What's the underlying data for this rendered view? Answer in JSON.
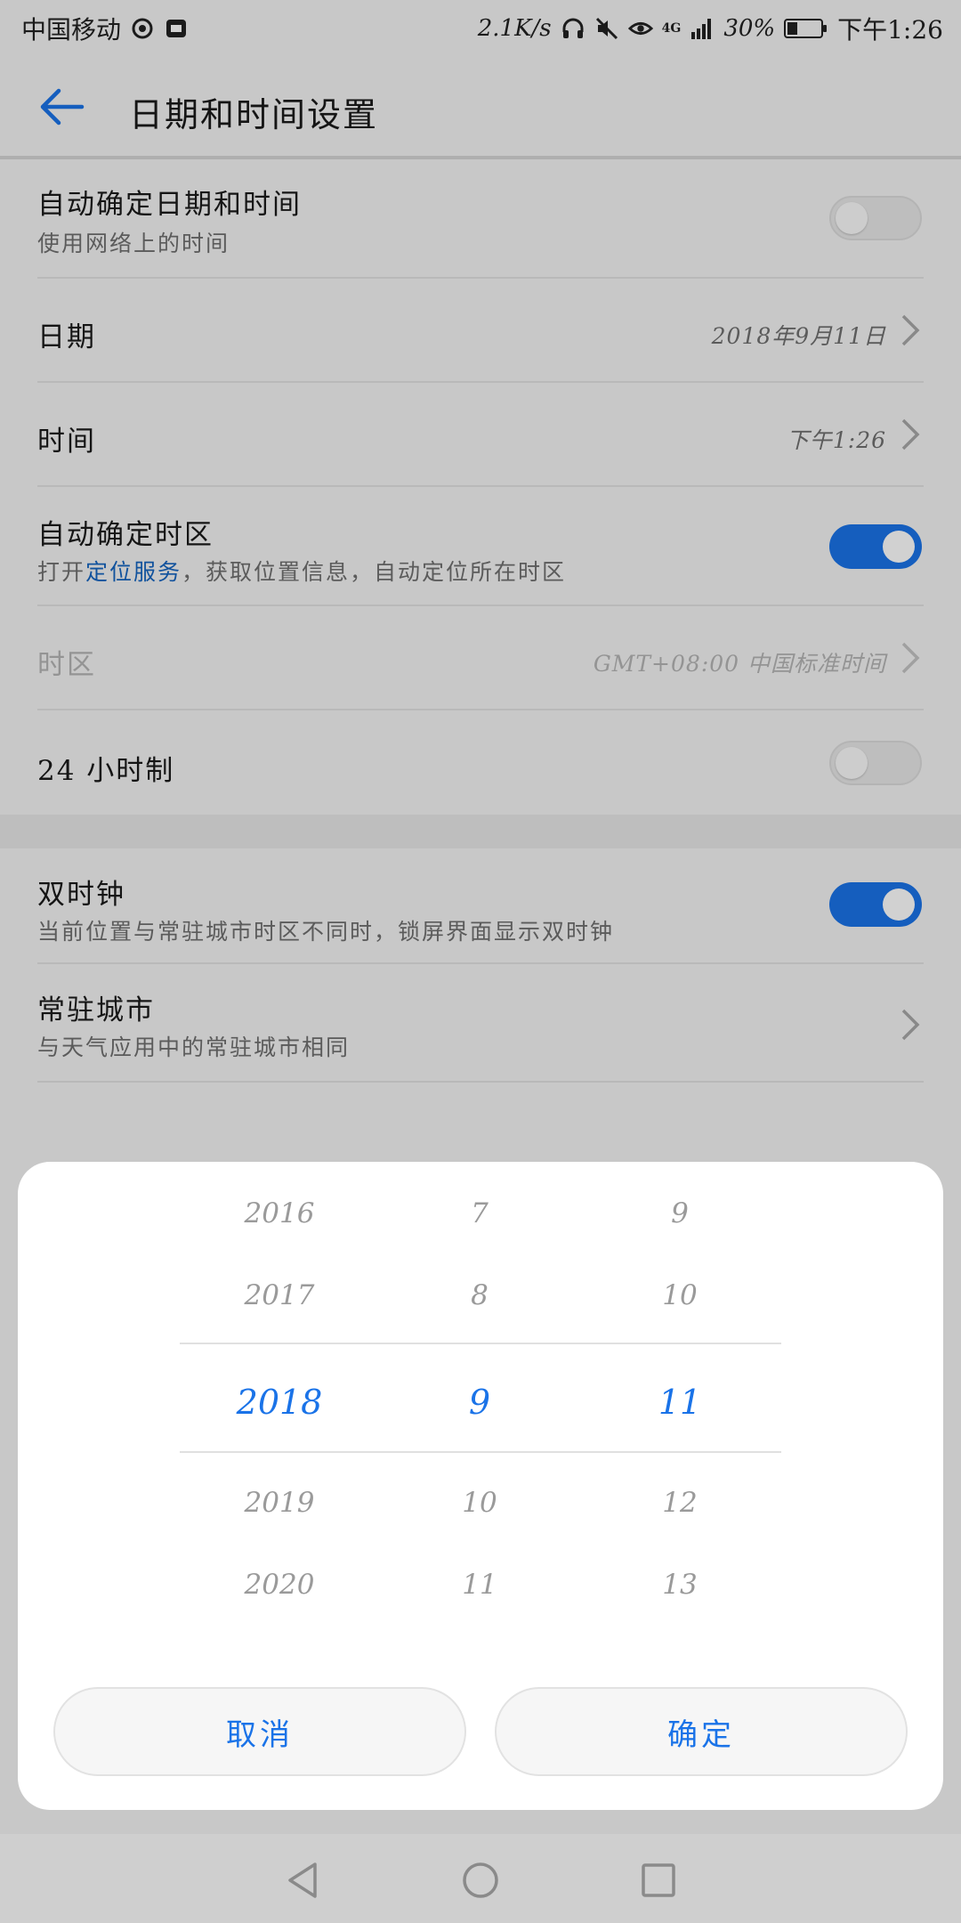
{
  "status_bar": {
    "carrier": "中国移动",
    "net_speed": "2.1K/s",
    "network": "4G",
    "battery": "30%",
    "battery_level": 0.3,
    "time": "下午1:26",
    "icons": [
      "weibo-icon",
      "app-notify-icon",
      "headset-icon",
      "mute-icon",
      "eye-comfort-icon",
      "signal-icon",
      "battery-icon"
    ]
  },
  "app_bar": {
    "title": "日期和时间设置",
    "back_icon": "arrow-left-icon"
  },
  "settings": {
    "auto_datetime": {
      "title": "自动确定日期和时间",
      "subtitle": "使用网络上的时间",
      "enabled": false
    },
    "date": {
      "title": "日期",
      "value": "2018年9月11日"
    },
    "time": {
      "title": "时间",
      "value": "下午1:26"
    },
    "auto_timezone": {
      "title": "自动确定时区",
      "subtitle_prefix": "打开",
      "subtitle_link": "定位服务",
      "subtitle_suffix": "，获取位置信息，自动定位所在时区",
      "enabled": true
    },
    "timezone": {
      "title": "时区",
      "value": "GMT+08:00  中国标准时间",
      "disabled": true
    },
    "hour24": {
      "title": "24 小时制",
      "enabled": false
    },
    "dual_clock": {
      "title": "双时钟",
      "subtitle": "当前位置与常驻城市时区不同时，锁屏界面显示双时钟",
      "enabled": true
    },
    "home_city": {
      "title": "常驻城市",
      "subtitle": "与天气应用中的常驻城市相同"
    }
  },
  "date_picker": {
    "years": [
      "2016",
      "2017",
      "2018",
      "2019",
      "2020"
    ],
    "months": [
      "7",
      "8",
      "9",
      "10",
      "11"
    ],
    "days": [
      "9",
      "10",
      "11",
      "12",
      "13"
    ],
    "selected_index": 2,
    "cancel_label": "取消",
    "confirm_label": "确定"
  },
  "colors": {
    "accent": "#1a73e8",
    "link": "#1565c0",
    "text_primary": "#1a1a1a",
    "text_secondary": "#707070"
  },
  "nav_bar": {
    "icons": [
      "back-triangle-icon",
      "home-circle-icon",
      "recents-square-icon"
    ]
  }
}
